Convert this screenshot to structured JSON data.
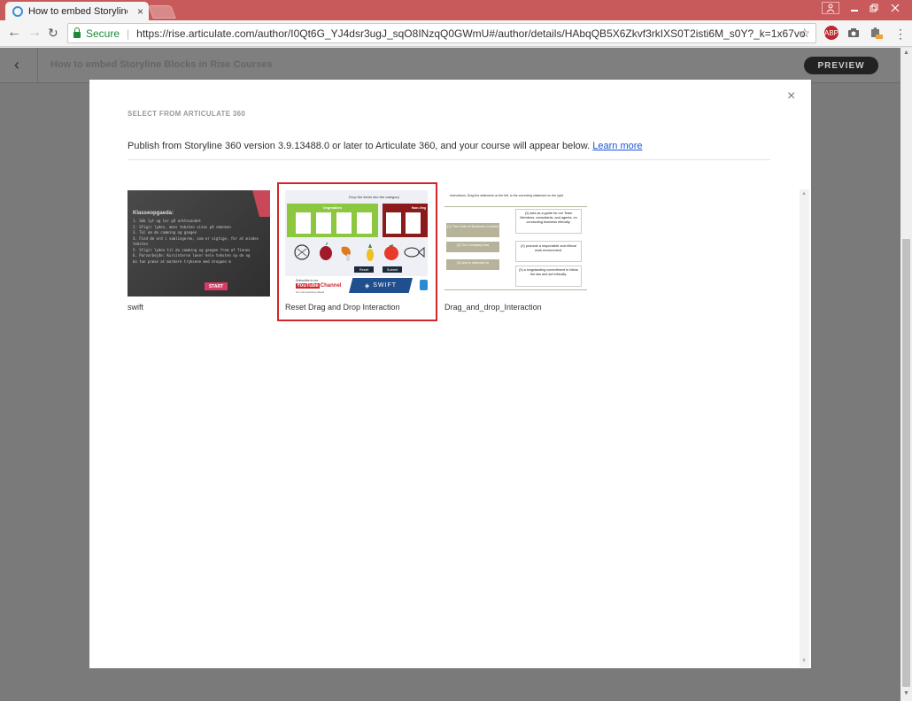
{
  "browser": {
    "tab_title": "How to embed Storyline",
    "tab_close": "×",
    "secure_label": "Secure",
    "url": "https://rise.articulate.com/author/I0Qt6G_YJ4dsr3ugJ_sqO8INzqQ0GWmU#/author/details/HAbqQB5X6Zkvf3rkIXS0T2isti6M_s0Y?_k=1x67vo"
  },
  "rise": {
    "course_title": "How to embed Storyline Blocks in Rise Courses",
    "preview_label": "PREVIEW"
  },
  "modal": {
    "heading": "SELECT FROM ARTICULATE 360",
    "intro_text": "Publish from Storyline 360 version 3.9.13488.0 or later to Articulate 360, and your course will appear below.",
    "learn_more": "Learn more",
    "close": "×",
    "items": [
      {
        "label": "swift",
        "thumb": {
          "title": "Klasseopgaeda:",
          "lines": [
            "1. Skb lyt og tar på arktesandet",
            "2. Sfigir lyden, mens teksten vises på skærmen",
            "3. Tal om de camming og gangen",
            "4. Find de ord i samlingerne, som er vigtige, for at mindes",
            "teksten",
            "5. Sfigir lyden til de camming og gangen frem af finnes",
            "6. Parvarbejde: Kursisterne læser hele teksten op de og",
            "   bo tun prøve at markere tryksene med droppen m"
          ],
          "start": "START"
        }
      },
      {
        "label": "Reset Drag and Drop Interaction",
        "thumb": {
          "instruction": "Drop the items into the category.",
          "cat1": "Vegetables",
          "cat2": "Non-Veg",
          "reset": "Reset",
          "submit": "Submit",
          "subscribe": "Subscribe to our",
          "youtube": "YouTube",
          "channel": "Channel",
          "yt_sub": "for more learning videos",
          "swift": "SWIFT"
        }
      },
      {
        "label": "Drag_and_drop_Interaction",
        "thumb": {
          "instruction": "Instructions: Drag the statement on the left, to the correcting statement on the right.",
          "drags": [
            "(1) The Code of Business Conduct",
            "(2) Our Company has",
            "(3) And is intended to"
          ],
          "targets": [
            "(1) acts as a guide for our Team Members, consultants, and agents, on conducting business ethically.",
            "(2) promote a responsible and ethical work environment.",
            "(3) a longstanding commitment to follow the law and act ethically."
          ]
        }
      }
    ]
  },
  "colors": {
    "titlebar": "#c85a5c",
    "selection_border": "#d1262c",
    "link": "#1a55d6",
    "veg_green": "#8dc63f",
    "nonveg_red": "#8b1a1a",
    "swift_blue": "#1f4f8f"
  }
}
